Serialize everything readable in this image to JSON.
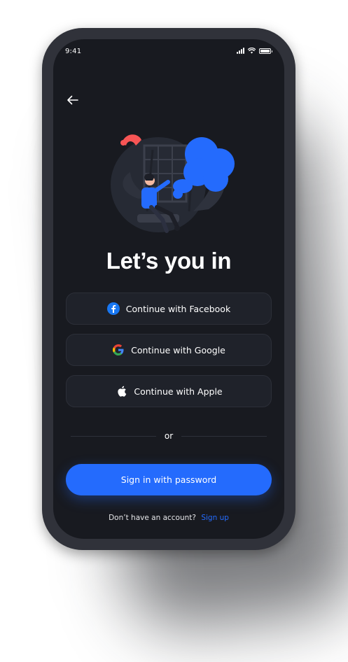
{
  "status_bar": {
    "time": "9:41",
    "signal_icon": "cellular-signal-icon",
    "wifi_icon": "wifi-icon",
    "battery_icon": "battery-icon"
  },
  "nav": {
    "back_icon": "arrow-left-icon"
  },
  "illustration": {
    "name": "person-on-swing-illustration"
  },
  "heading": "Let’s you in",
  "social_buttons": [
    {
      "label": "Continue with Facebook",
      "icon": "facebook-icon"
    },
    {
      "label": "Continue with Google",
      "icon": "google-icon"
    },
    {
      "label": "Continue with Apple",
      "icon": "apple-icon"
    }
  ],
  "divider": {
    "label": "or"
  },
  "primary_button": {
    "label": "Sign in with password"
  },
  "footer": {
    "prompt": "Don’t have an account?",
    "link": "Sign up"
  },
  "colors": {
    "background": "#181a20",
    "device_frame": "#30323a",
    "card": "#1f222a",
    "accent": "#246bfd",
    "illustration_pink": "#f75555"
  }
}
